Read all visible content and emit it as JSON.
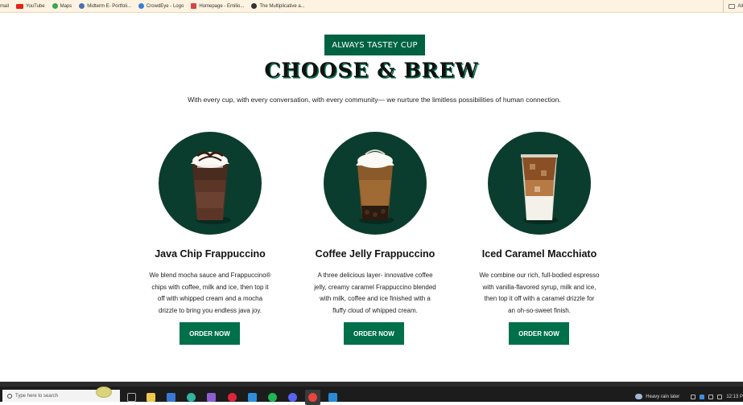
{
  "bookmarks": {
    "items": [
      {
        "label": "mail",
        "icon": "none",
        "color": ""
      },
      {
        "label": "YouTube",
        "icon": "youtube-icon",
        "color": "#e62117"
      },
      {
        "label": "Maps",
        "icon": "maps-pin-icon",
        "color": "#34a853"
      },
      {
        "label": "Midterm E- Portfoli...",
        "icon": "globe-icon",
        "color": "#4a6fb5"
      },
      {
        "label": "CrowdEye - Logo",
        "icon": "globe-icon",
        "color": "#3d7bd9"
      },
      {
        "label": "Homepage - Emilio...",
        "icon": "bookmark-icon",
        "color": "#d64545"
      },
      {
        "label": "The Multiplicative a...",
        "icon": "globe-icon",
        "color": "#333333"
      }
    ],
    "right_label": "All"
  },
  "hero": {
    "tag": "ALWAYS TASTEY CUP",
    "headline": "CHOOSE & BREW",
    "subtitle": "With every cup, with every conversation, with every community— we nurture the limitless possibilities of human connection."
  },
  "products": [
    {
      "title": "Java Chip Frappuccino",
      "desc": [
        "We blend mocha sauce and Frappuccino®",
        "chips with coffee, milk and ice, then top it",
        "off with whipped cream and a mocha",
        "drizzle to bring you endless java joy."
      ],
      "button": "ORDER NOW",
      "image": "java-chip-frappuccino-cup"
    },
    {
      "title": "Coffee Jelly Frappuccino",
      "desc": [
        "A three delicious layer- innovative coffee",
        "jelly, creamy caramel Frappuccino blended",
        "with milk, coffee and ice finished with a",
        "fluffy cloud of whipped cream."
      ],
      "button": "ORDER NOW",
      "image": "coffee-jelly-frappuccino-cup"
    },
    {
      "title": "Iced Caramel Macchiato",
      "desc": [
        "We combine our rich, full-bodied espresso",
        "with vanilla-flavored syrup, milk and ice,",
        "then top it off with a caramel drizzle for",
        "an oh-so-sweet finish."
      ],
      "button": "ORDER NOW",
      "image": "iced-caramel-macchiato-cup"
    }
  ],
  "taskbar": {
    "search_placeholder": "Type here to search",
    "weather": "Heavy rain later",
    "clock": "12:13 P"
  },
  "colors": {
    "brand_green": "#006241",
    "button_green": "#00704a",
    "circle_green": "#0b3d2e",
    "bookmark_bar": "#fdf3e0"
  }
}
